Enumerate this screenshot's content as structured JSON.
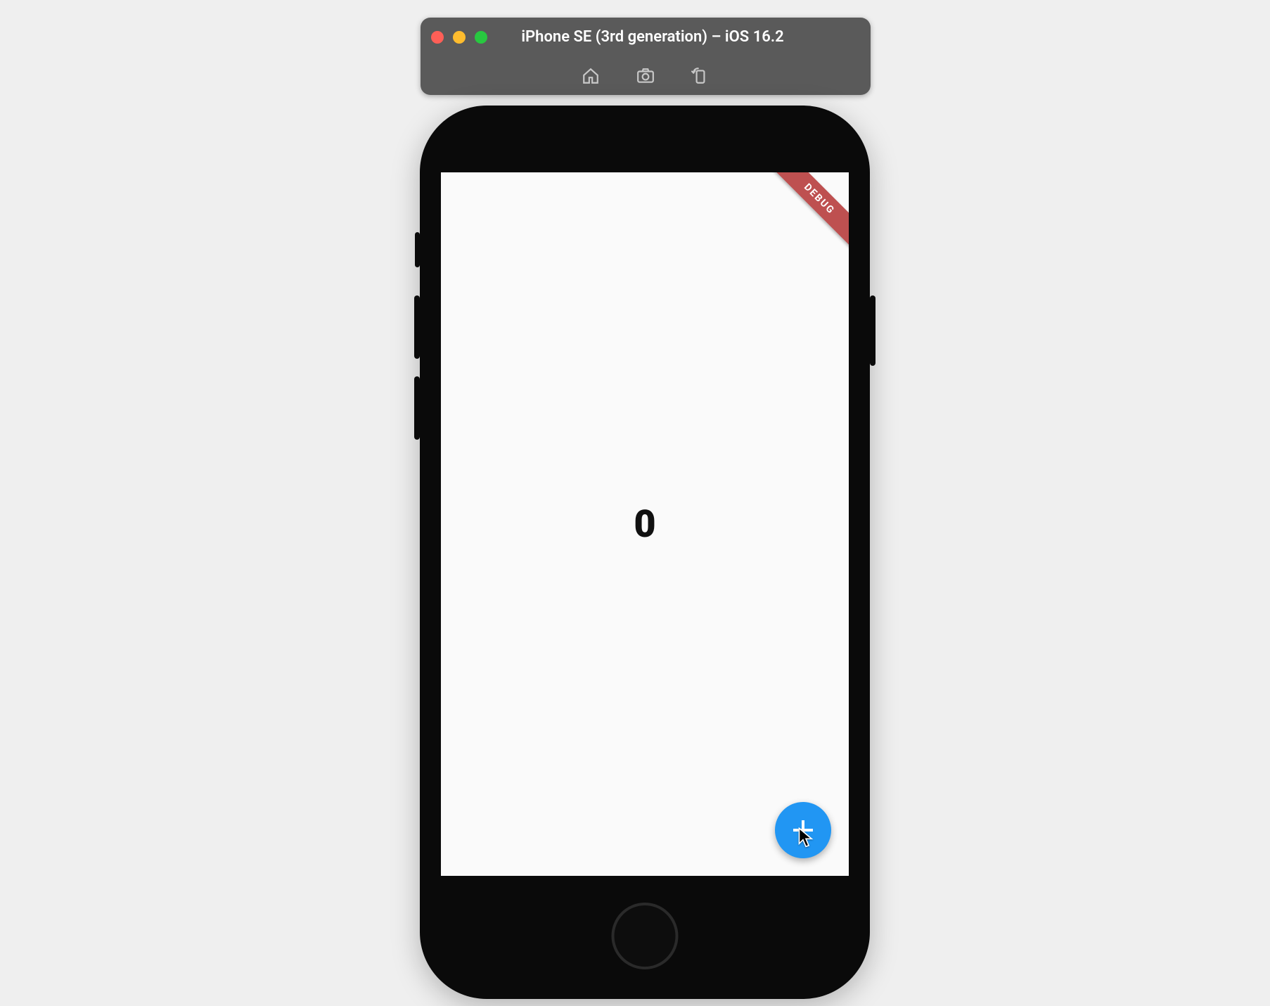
{
  "simulator": {
    "title": "iPhone SE (3rd generation) – iOS 16.2",
    "traffic_lights": [
      "close",
      "minimize",
      "maximize"
    ],
    "toolbar_icons": {
      "home": "home-icon",
      "screenshot": "screenshot-icon",
      "rotate": "rotate-icon"
    }
  },
  "app": {
    "counter_value": "0",
    "fab_icon": "plus-icon",
    "debug_banner": "DEBUG"
  },
  "colors": {
    "fab": "#2196f3",
    "debug_banner": "#be5050",
    "toolbar_bg": "#5a5a5a"
  }
}
